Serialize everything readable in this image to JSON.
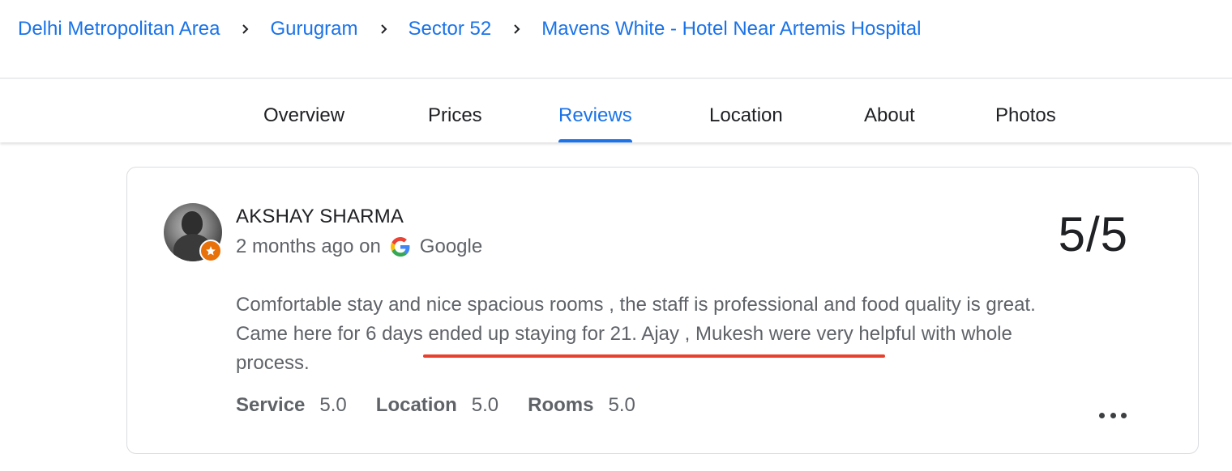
{
  "breadcrumb": {
    "items": [
      {
        "label": "Delhi Metropolitan Area"
      },
      {
        "label": "Gurugram"
      },
      {
        "label": "Sector 52"
      },
      {
        "label": "Mavens White - Hotel Near Artemis Hospital"
      }
    ],
    "separator_icon": "chevron-right-icon"
  },
  "tabs": [
    {
      "label": "Overview",
      "active": false
    },
    {
      "label": "Prices",
      "active": false
    },
    {
      "label": "Reviews",
      "active": true
    },
    {
      "label": "Location",
      "active": false
    },
    {
      "label": "About",
      "active": false
    },
    {
      "label": "Photos",
      "active": false
    }
  ],
  "review": {
    "reviewer_name": "AKSHAY SHARMA",
    "time_ago": "2 months ago on",
    "source": "Google",
    "score": "5/5",
    "text": "Comfortable stay and nice spacious rooms , the staff is professional and food quality is great. Came here for 6 days ended up staying for 21. Ajay , Mukesh were very helpful with whole process.",
    "ratings": [
      {
        "label": "Service",
        "value": "5.0"
      },
      {
        "label": "Location",
        "value": "5.0"
      },
      {
        "label": "Rooms",
        "value": "5.0"
      }
    ],
    "badge_icon": "star-badge-icon",
    "more_icon": "more-horizontal-icon"
  },
  "colors": {
    "link": "#1a73e8",
    "active_tab": "#1a73e8",
    "badge": "#e8710a",
    "annotation": "#e8402c"
  }
}
